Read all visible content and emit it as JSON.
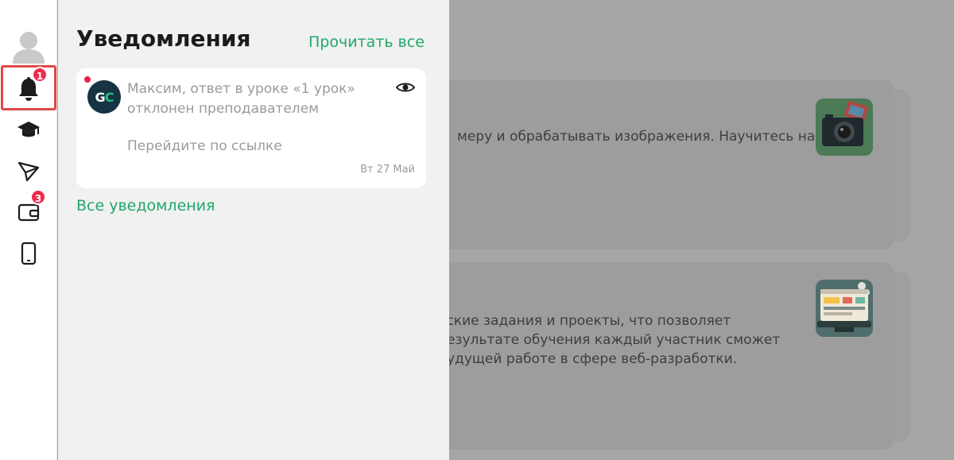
{
  "rail": {
    "notifications_badge": "1",
    "wallet_badge": "3"
  },
  "panel": {
    "title": "Уведомления",
    "read_all": "Прочитать все",
    "all_notifications": "Все уведомления",
    "notification": {
      "logo_left": "G",
      "logo_right": "C",
      "message": "Максим, ответ в уроке «1 урок» отклонен преподавателем",
      "link_text": "Перейдите по ссылке",
      "date": "Вт 27 Май"
    }
  },
  "background": {
    "card1_text": "меру и обрабатывать изображения. Научитесь на",
    "card2_line1": "еские задания и проекты, что позволяет",
    "card2_line2": "езультате обучения каждый участник сможет",
    "card2_line3": "удущей работе в сфере веб-разработки."
  },
  "colors": {
    "accent": "#20a86b",
    "badge": "#ef2b4c",
    "highlight_frame": "#e04848"
  }
}
